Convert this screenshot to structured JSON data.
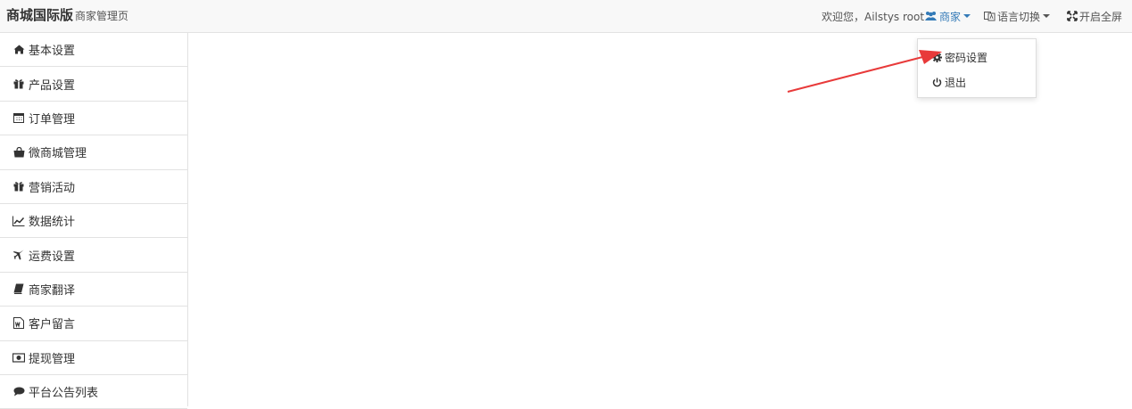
{
  "header": {
    "brand_title": "商城国际版",
    "brand_subtitle": "商家管理页",
    "welcome_text": "欢迎您，Ailstys root",
    "merchant_label": "商家",
    "language_label": "语言切换",
    "fullscreen_label": "开启全屏"
  },
  "sidebar": {
    "items": [
      {
        "label": "基本设置",
        "icon": "home-icon"
      },
      {
        "label": "产品设置",
        "icon": "gift-icon"
      },
      {
        "label": "订单管理",
        "icon": "calendar-icon"
      },
      {
        "label": "微商城管理",
        "icon": "shopping-bag-icon"
      },
      {
        "label": "营销活动",
        "icon": "gift-icon"
      },
      {
        "label": "数据统计",
        "icon": "line-chart-icon"
      },
      {
        "label": "运费设置",
        "icon": "plane-icon"
      },
      {
        "label": "商家翻译",
        "icon": "book-icon"
      },
      {
        "label": "客户留言",
        "icon": "document-icon"
      },
      {
        "label": "提现管理",
        "icon": "money-icon"
      },
      {
        "label": "平台公告列表",
        "icon": "comment-icon"
      }
    ]
  },
  "dropdown": {
    "password_label": "密码设置",
    "logout_label": "退出"
  },
  "colors": {
    "accent": "#337ab7",
    "arrow": "#e83a3a"
  }
}
